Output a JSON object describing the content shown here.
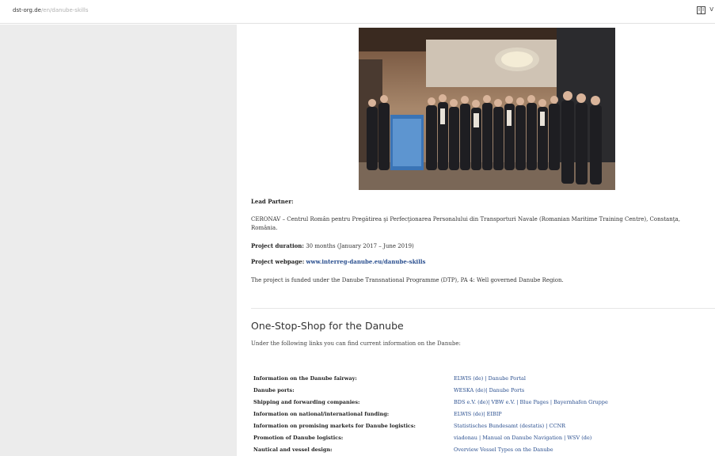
{
  "browser": {
    "url_host": "dst-org.de",
    "url_path": "/en/danube-skills",
    "reader_view_icon": "book-icon",
    "menu_chevron": "v"
  },
  "project": {
    "lead_partner_label": "Lead Partner:",
    "lead_partner_text_line1": "CERONAV – Centrul Român pentru Pregătirea şi Perfecţionarea Personalului din Transporturi Navale (Romanian Maritime Training Centre), Constanţa,",
    "lead_partner_text_line2": "România.",
    "duration_label": "Project duration:",
    "duration_value": " 30 months (January 2017 – June 2019)",
    "webpage_label": "Project webpage:",
    "webpage_link": "www.interreg-danube.eu/danube-skills",
    "funding_text": "The project is funded under the Danube Transnational Programme (DTP), PA 4: Well governed Danube Region."
  },
  "one_stop_shop": {
    "heading": "One-Stop-Shop for the Danube",
    "intro": "Under the following links you can find current information on the Danube:",
    "rows": [
      {
        "label": "Information on the Danube fairway:",
        "value": "ELWIS (de) | Danube Portal"
      },
      {
        "label": "Danube ports:",
        "value": "WESKA (de)| Danube Ports"
      },
      {
        "label": "Shipping and forwarding companies:",
        "value": "BDS e.V. (de)| VBW e.V. | Blue Pages | Bayernhafen Gruppe"
      },
      {
        "label": "Information on national/international funding:",
        "value": "ELWIS (de)| EIBIP"
      },
      {
        "label": "Information on promising markets for Danube logistics:",
        "value": "Statistisches Bundesamt (destatis) | CCNR"
      },
      {
        "label": "Promotion of Danube logistics:",
        "value": "viadonau | Manual on Danube Navigation | WSV (de)"
      },
      {
        "label": "Nautical and vessel design:",
        "value": "Overview Vessel Types on the Danube"
      }
    ]
  }
}
